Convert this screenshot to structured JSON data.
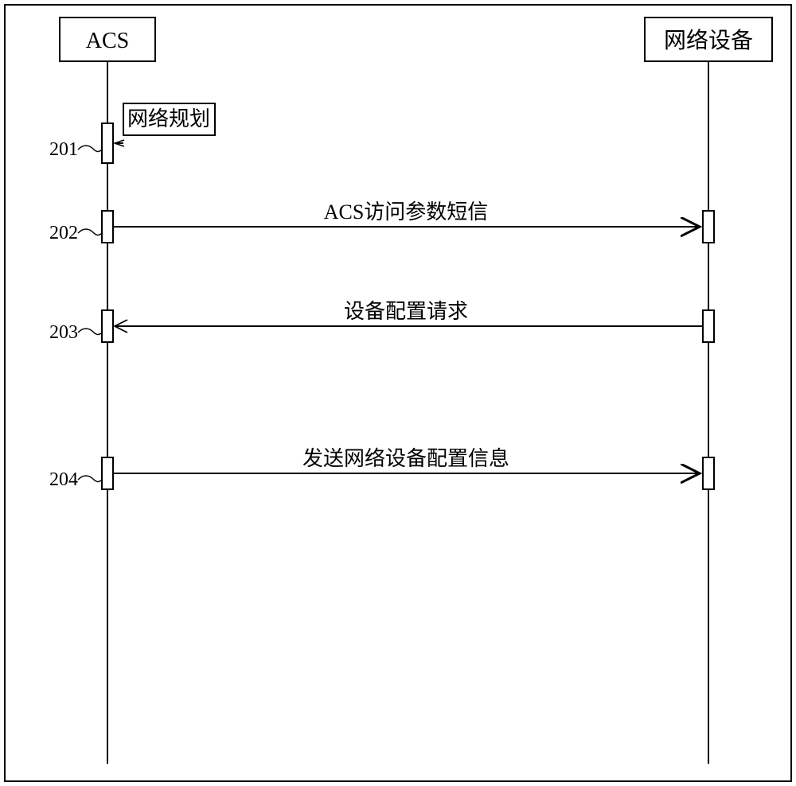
{
  "chart_data": {
    "type": "sequence-diagram",
    "participants": [
      {
        "id": "acs",
        "label": "ACS"
      },
      {
        "id": "device",
        "label": "网络设备"
      }
    ],
    "steps": [
      {
        "num": "201",
        "label": "网络规划",
        "from": "self",
        "to": "acs",
        "direction": "self"
      },
      {
        "num": "202",
        "label": "ACS访问参数短信",
        "from": "acs",
        "to": "device",
        "direction": "right"
      },
      {
        "num": "203",
        "label": "设备配置请求",
        "from": "device",
        "to": "acs",
        "direction": "left"
      },
      {
        "num": "204",
        "label": "发送网络设备配置信息",
        "from": "acs",
        "to": "device",
        "direction": "right"
      }
    ]
  },
  "participants": {
    "acs": "ACS",
    "device": "网络设备"
  },
  "steps": {
    "s201": {
      "num": "201",
      "label": "网络规划"
    },
    "s202": {
      "num": "202",
      "label": "ACS访问参数短信"
    },
    "s203": {
      "num": "203",
      "label": "设备配置请求"
    },
    "s204": {
      "num": "204",
      "label": "发送网络设备配置信息"
    }
  }
}
